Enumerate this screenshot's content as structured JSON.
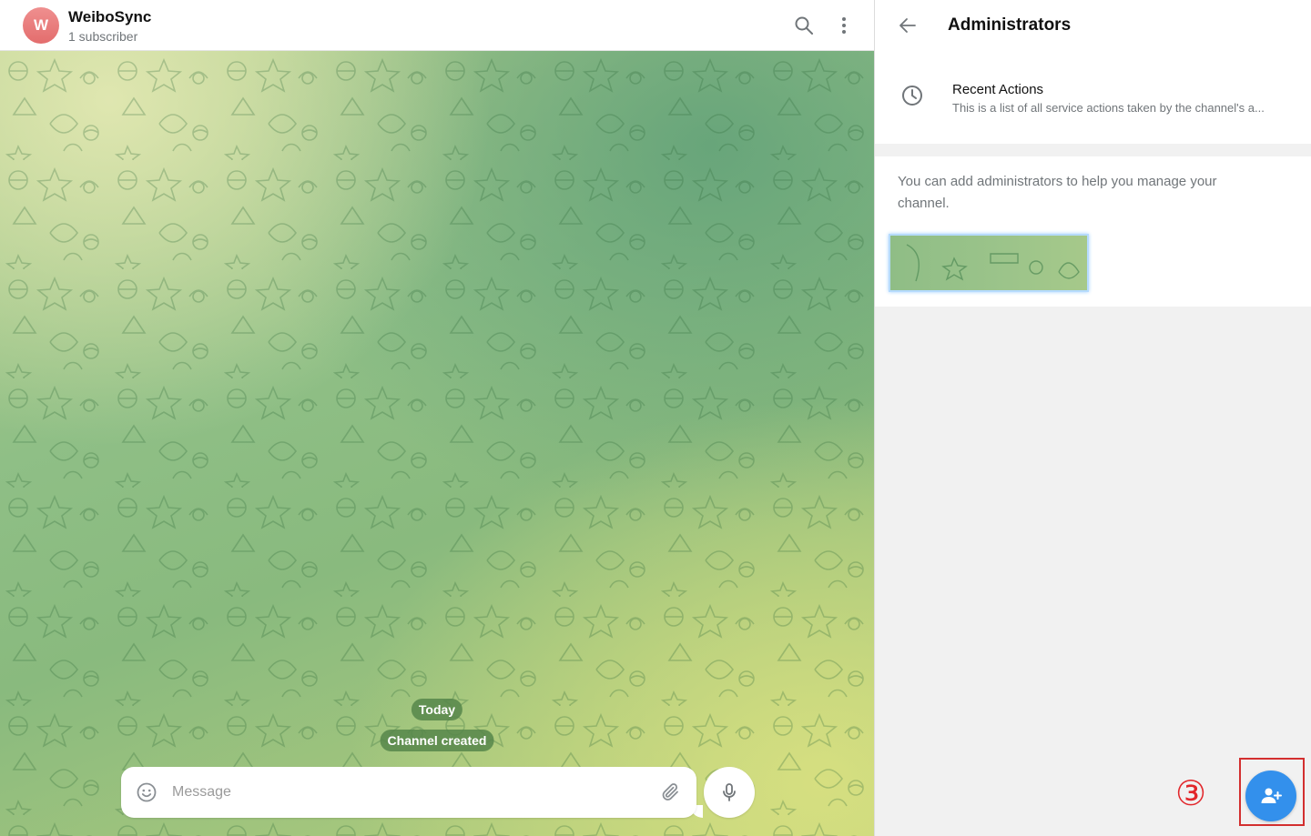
{
  "chat": {
    "avatar_letter": "W",
    "title": "WeiboSync",
    "subtitle": "1 subscriber",
    "date_label": "Today",
    "service_message": "Channel created",
    "composer": {
      "placeholder": "Message"
    },
    "icons": {
      "search": "search-icon",
      "menu": "more-vertical-icon",
      "emoji": "smile-icon",
      "attach": "paperclip-icon",
      "mic": "microphone-icon"
    }
  },
  "panel": {
    "title": "Administrators",
    "recent_actions": {
      "title": "Recent Actions",
      "description": "This is a list of all service actions taken by the channel's a..."
    },
    "info_text": "You can add administrators to help you manage your channel.",
    "step_marker": "③",
    "icons": {
      "back": "arrow-left-icon",
      "recent": "clock-icon",
      "add_admin": "add-user-icon"
    }
  },
  "colors": {
    "accent": "#3390ec",
    "avatar": "#e36d6d",
    "annotation": "#d32f2f"
  }
}
